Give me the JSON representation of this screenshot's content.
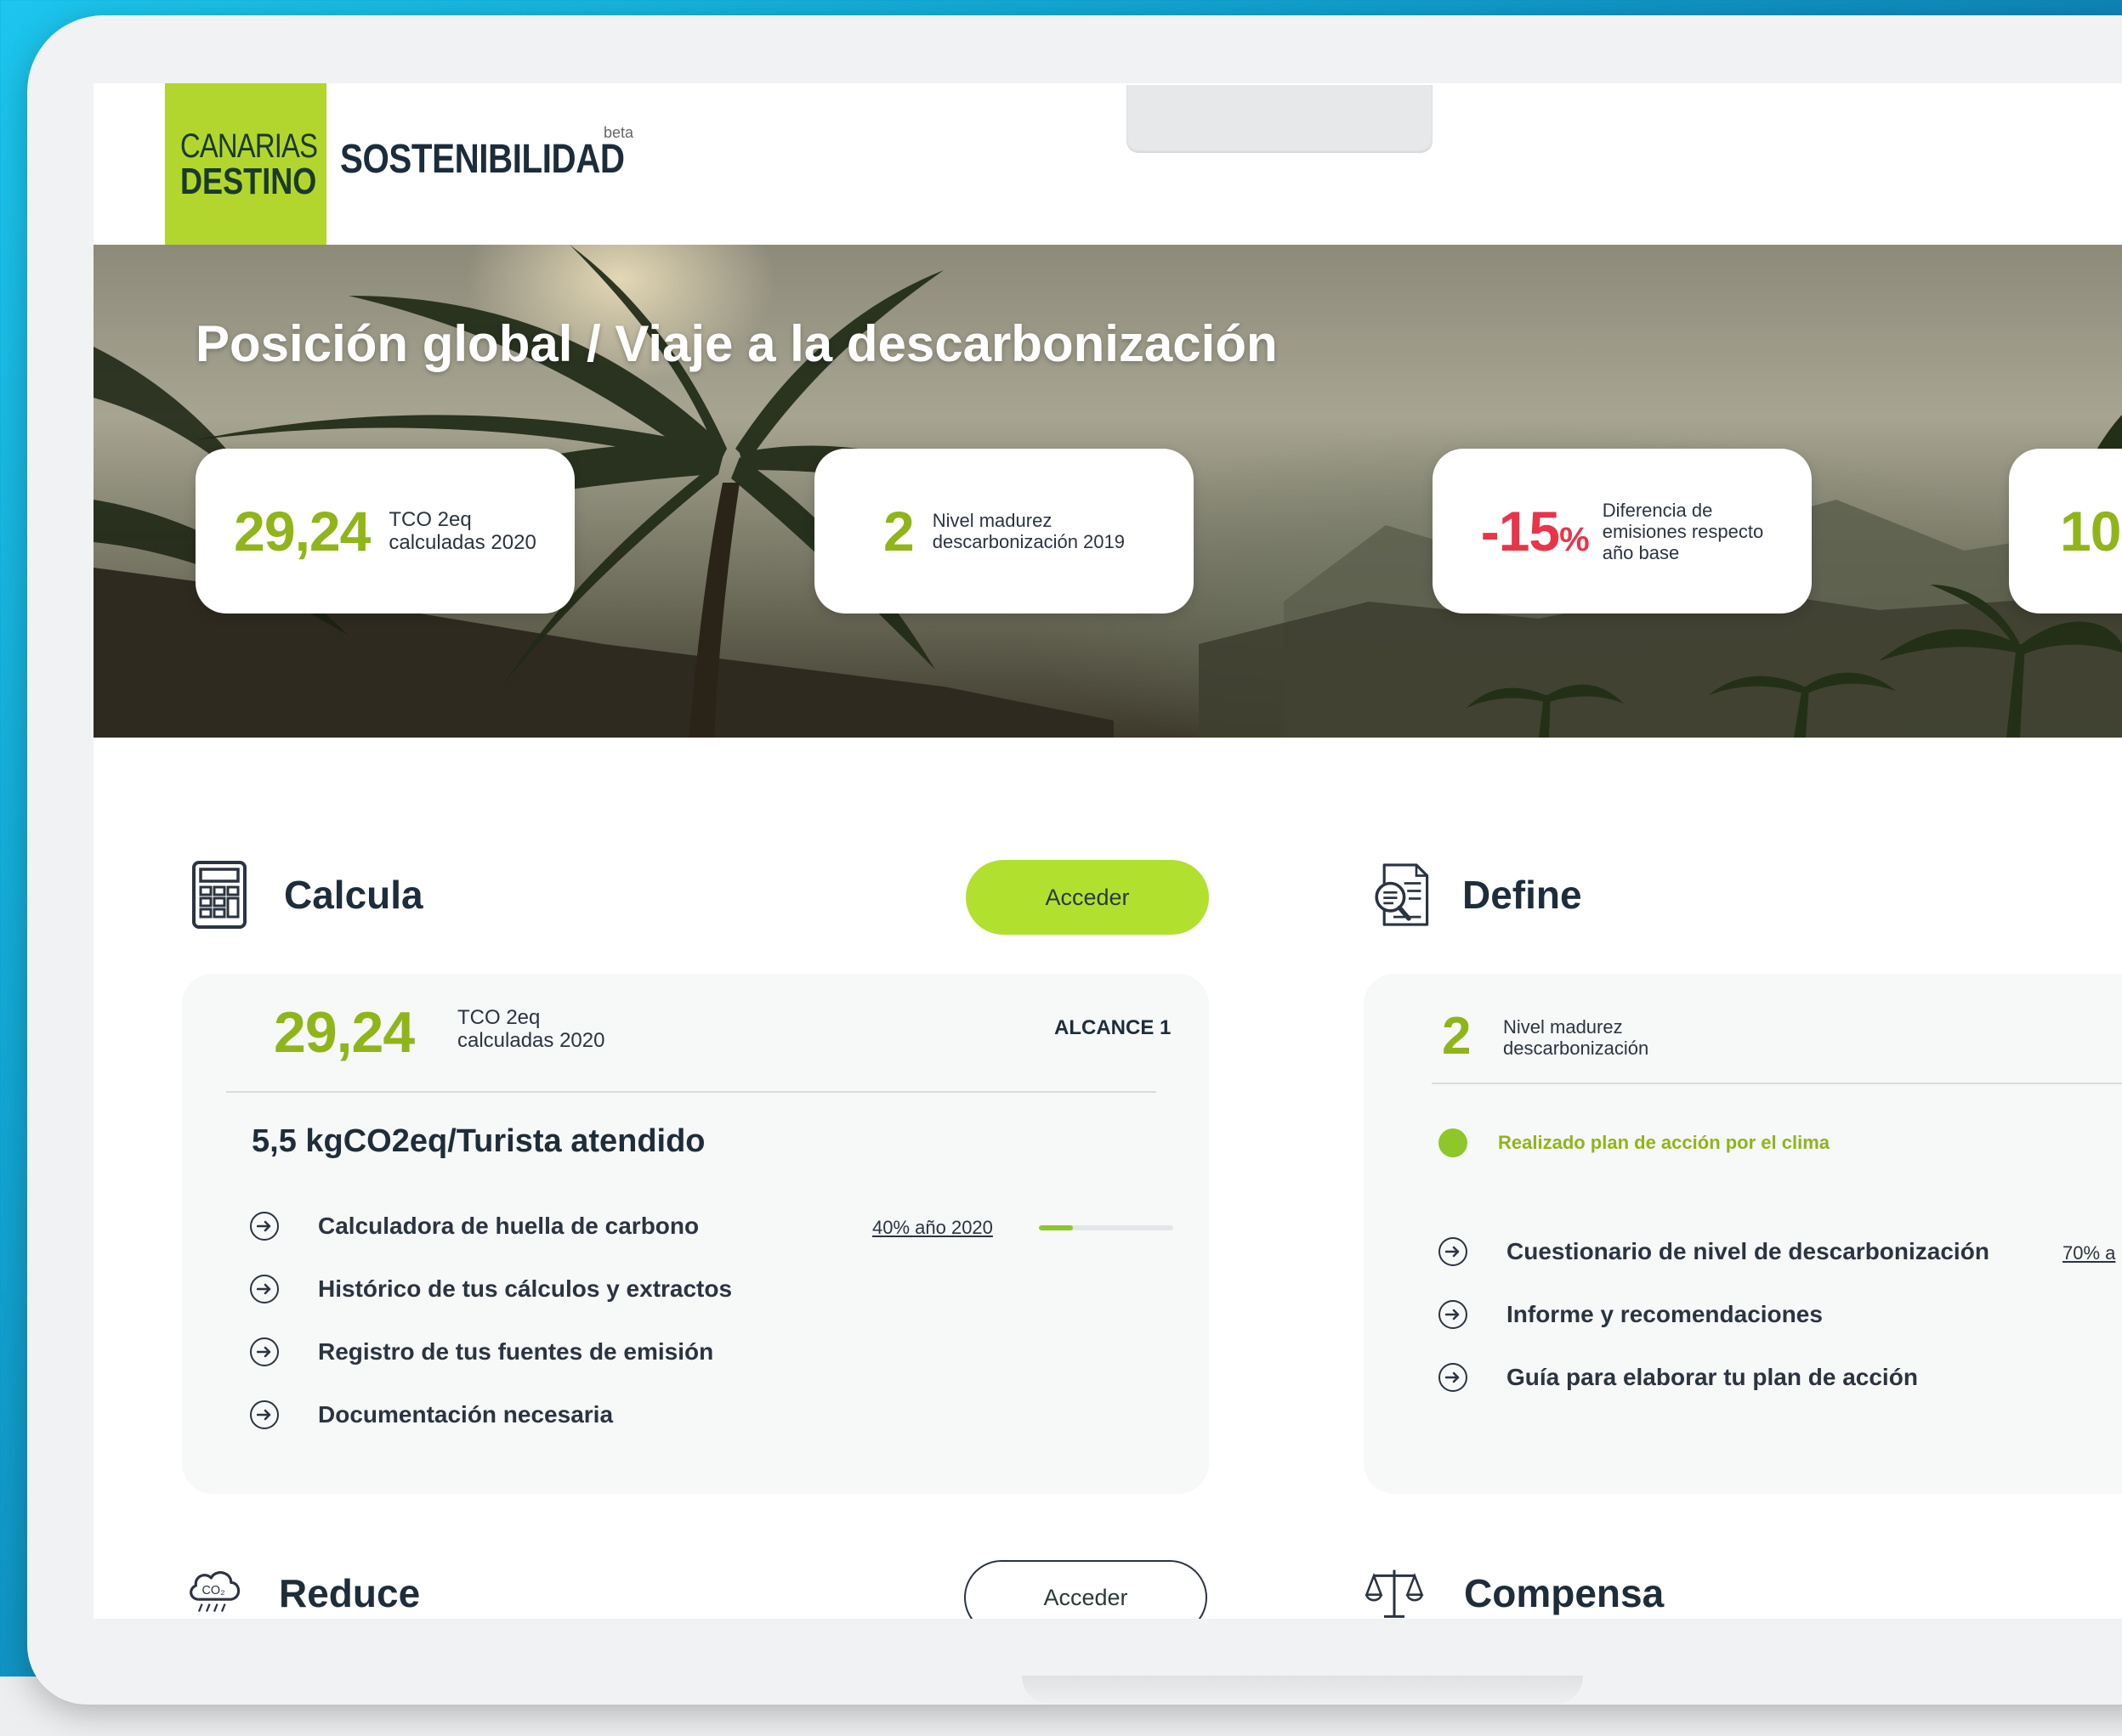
{
  "header": {
    "logo_line1": "CANARIAS",
    "logo_line2": "DESTINO",
    "brand": "SOSTENIBILIDAD",
    "beta": "beta"
  },
  "hero": {
    "title": "Posición global / Viaje a la descarbonización",
    "stats": [
      {
        "value": "29,24",
        "label_line1": "TCO 2eq",
        "label_line2": "calculadas 2020"
      },
      {
        "value": "2",
        "label_line1": "Nivel madurez",
        "label_line2": "descarbonización 2019"
      },
      {
        "value": "-15",
        "unit": "%",
        "label_line1": "Diferencia de",
        "label_line2": "emisiones respecto",
        "label_line3": "año base"
      },
      {
        "value": "10"
      }
    ]
  },
  "calcula": {
    "title": "Calcula",
    "button": "Acceder",
    "big_value": "29,24",
    "label_line1": "TCO 2eq",
    "label_line2": "calculadas 2020",
    "scope": "ALCANCE 1",
    "metric": "5,5 kgCO2eq/Turista atendido",
    "links": [
      {
        "label": "Calculadora de huella de carbono",
        "progress_label": "40% año 2020",
        "progress": 0.25
      },
      {
        "label": "Histórico de tus cálculos y extractos"
      },
      {
        "label": "Registro de tus fuentes de emisión"
      },
      {
        "label": "Documentación necesaria"
      }
    ]
  },
  "define": {
    "title": "Define",
    "big_value": "2",
    "label_line1": "Nivel madurez",
    "label_line2": "descarbonización",
    "status": "Realizado plan de acción por el clima",
    "links": [
      {
        "label": "Cuestionario de nivel de descarbonización",
        "progress_label": "70% a"
      },
      {
        "label": "Informe y recomendaciones"
      },
      {
        "label": "Guía para elaborar tu plan de acción"
      }
    ]
  },
  "reduce": {
    "title": "Reduce",
    "button": "Acceder"
  },
  "compensa": {
    "title": "Compensa"
  },
  "colors": {
    "accent": "#b2d62d",
    "green_text": "#8fb51a",
    "red": "#e8354a"
  }
}
